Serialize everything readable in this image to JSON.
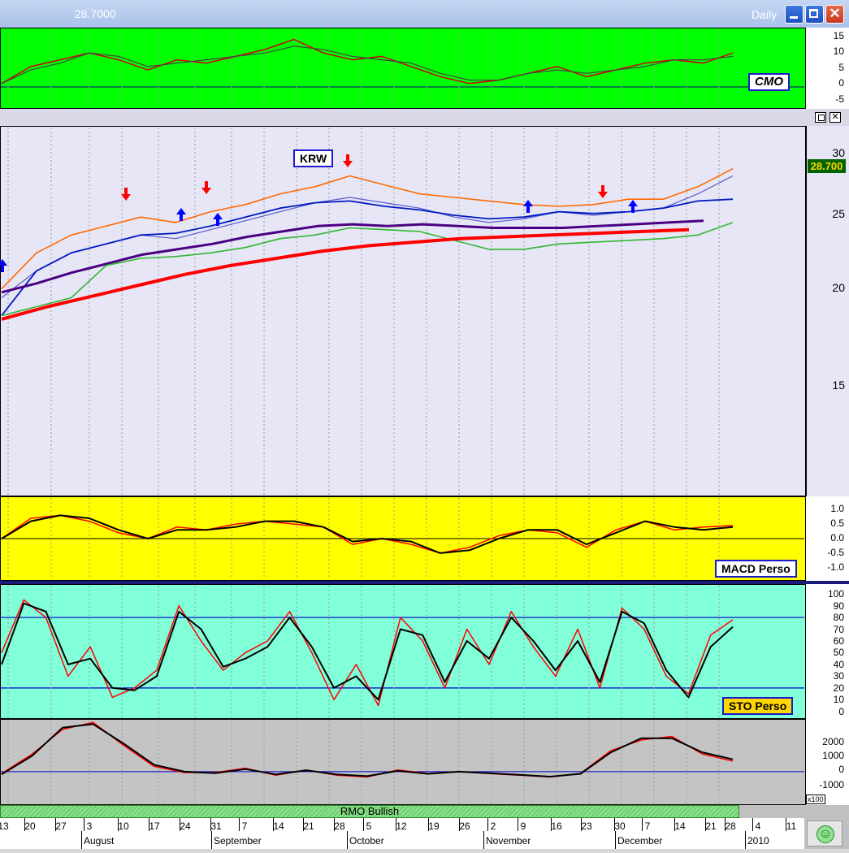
{
  "window": {
    "title_value": "28.7000",
    "period": "Daily"
  },
  "icons": {
    "minimize": "minimize-icon",
    "restore": "restore-icon",
    "close": "close-icon",
    "smiley": "smiley-icon"
  },
  "colors": {
    "cmo_bg": "#00ff00",
    "price_bg": "#e6e6f7",
    "macd_bg": "#ffff00",
    "sto_bg": "#80ffd9",
    "rmo_bg": "#c4c4c4"
  },
  "cmo": {
    "label": "CMO",
    "axis": [
      "15",
      "10",
      "5",
      "0",
      "-5"
    ],
    "chart_data": {
      "type": "line",
      "series": [
        {
          "values": [
            1,
            6,
            8,
            10,
            8,
            5,
            8,
            7,
            9,
            11,
            14,
            10,
            8,
            9,
            6,
            3,
            1,
            2,
            4,
            6,
            3,
            5,
            7,
            8,
            7,
            10
          ]
        },
        {
          "values": [
            1,
            5,
            7,
            10,
            9,
            6,
            7,
            8,
            9,
            10,
            12,
            11,
            9,
            8,
            7,
            4,
            2,
            2,
            4,
            5,
            4,
            5,
            6,
            8,
            8,
            9
          ]
        }
      ],
      "ylim": [
        -6,
        17
      ]
    }
  },
  "price": {
    "symbol": "KRW",
    "last_price": "28.700",
    "axis": [
      "30",
      "25",
      "20",
      "15"
    ],
    "chart_data": {
      "type": "line",
      "ylim": [
        11,
        31.5
      ],
      "series": [
        {
          "values": [
            22.5,
            24.5,
            25.5,
            26,
            26.5,
            26.2,
            26.8,
            27.2,
            27.8,
            28.2,
            28.8,
            28.3,
            27.8,
            27.6,
            27.4,
            27.2,
            27.1,
            27.2,
            27.5,
            27.5,
            28.2,
            29.2
          ]
        },
        {
          "values": [
            22,
            23.5,
            24.5,
            25,
            25.5,
            25.3,
            25.8,
            26.3,
            26.8,
            27.3,
            27.6,
            27.3,
            27,
            26.5,
            26.2,
            26.4,
            26.8,
            26.6,
            26.8,
            27,
            27.8,
            28.8
          ]
        },
        {
          "values": [
            21,
            23.5,
            24.5,
            25,
            25.5,
            25.6,
            26,
            26.5,
            27,
            27.3,
            27.4,
            27.1,
            26.9,
            26.6,
            26.4,
            26.5,
            26.8,
            26.7,
            26.8,
            27,
            27.4,
            27.5
          ]
        },
        {
          "values": [
            22.3,
            22.8,
            23.4,
            23.9,
            24.4,
            24.7,
            25,
            25.4,
            25.7,
            26,
            26.1,
            26,
            26.1,
            26,
            25.9,
            25.9,
            25.9,
            26,
            26.1,
            26.2,
            26.3
          ]
        },
        {
          "values": [
            21,
            21.5,
            22,
            23.8,
            24.2,
            24.3,
            24.5,
            24.8,
            25.3,
            25.5,
            25.9,
            25.8,
            25.7,
            25.2,
            24.7,
            24.7,
            25,
            25.1,
            25.2,
            25.3,
            25.5,
            26.2
          ]
        },
        {
          "values": [
            20.8,
            21.5,
            22.1,
            22.7,
            23.3,
            23.8,
            24.2,
            24.6,
            24.9,
            25.1,
            25.3,
            25.4,
            25.5,
            25.6,
            25.7,
            25.8
          ]
        }
      ]
    }
  },
  "macd": {
    "label": "MACD Perso",
    "axis": [
      "1.0",
      "0.5",
      "0.0",
      "-0.5",
      "-1.0"
    ],
    "chart_data": {
      "type": "line",
      "ylim": [
        -1.4,
        1.4
      ],
      "series": [
        {
          "values": [
            0,
            0.7,
            0.8,
            0.6,
            0.2,
            0,
            0.4,
            0.3,
            0.5,
            0.6,
            0.5,
            0.4,
            -0.2,
            0,
            -0.2,
            -0.5,
            -0.3,
            0.1,
            0.3,
            0.2,
            -0.3,
            0.3,
            0.6,
            0.3,
            0.4,
            0.45
          ]
        },
        {
          "values": [
            0,
            0.6,
            0.8,
            0.7,
            0.3,
            0,
            0.3,
            0.3,
            0.4,
            0.6,
            0.6,
            0.4,
            -0.1,
            0,
            -0.1,
            -0.5,
            -0.4,
            0,
            0.3,
            0.3,
            -0.2,
            0.2,
            0.6,
            0.4,
            0.3,
            0.4
          ]
        }
      ]
    }
  },
  "sto": {
    "label": "STO Perso",
    "axis": [
      "100",
      "90",
      "80",
      "70",
      "60",
      "50",
      "40",
      "30",
      "20",
      "10",
      "0"
    ],
    "levels": [
      80,
      20
    ],
    "chart_data": {
      "type": "line",
      "ylim": [
        -5,
        107
      ],
      "series": [
        {
          "values": [
            50,
            95,
            80,
            30,
            55,
            12,
            20,
            35,
            90,
            60,
            35,
            50,
            60,
            85,
            50,
            10,
            40,
            5,
            80,
            60,
            20,
            70,
            40,
            85,
            55,
            30,
            70,
            20,
            88,
            70,
            30,
            15,
            65,
            78
          ]
        },
        {
          "values": [
            40,
            92,
            85,
            40,
            45,
            20,
            18,
            30,
            85,
            70,
            38,
            45,
            55,
            80,
            55,
            20,
            30,
            10,
            70,
            65,
            25,
            60,
            45,
            80,
            60,
            35,
            60,
            25,
            85,
            75,
            35,
            12,
            55,
            72
          ]
        }
      ]
    }
  },
  "rmo": {
    "label": "RMO Bullish",
    "axis": [
      "2000",
      "1000",
      "0",
      "-1000"
    ],
    "multiplier": "x100",
    "chart_data": {
      "type": "line",
      "ylim": [
        -1800,
        2900
      ],
      "series": [
        {
          "values": [
            -100,
            1000,
            2400,
            2800,
            1500,
            300,
            -50,
            -50,
            200,
            -200,
            100,
            -200,
            -300,
            100,
            -100,
            0,
            -100,
            -200,
            -300,
            -100,
            1200,
            1800,
            2000,
            1000,
            600
          ]
        },
        {
          "values": [
            -150,
            900,
            2500,
            2700,
            1600,
            400,
            0,
            -80,
            150,
            -150,
            80,
            -150,
            -250,
            50,
            -120,
            0,
            -80,
            -180,
            -280,
            -120,
            1100,
            1900,
            1900,
            1100,
            700
          ]
        }
      ]
    }
  },
  "dates": {
    "days": [
      "13",
      "20",
      "27",
      "3",
      "10",
      "17",
      "24",
      "31",
      "7",
      "14",
      "21",
      "28",
      "5",
      "12",
      "19",
      "26",
      "2",
      "9",
      "16",
      "23",
      "30",
      "7",
      "14",
      "21",
      "28",
      "4",
      "11"
    ],
    "months": [
      "August",
      "September",
      "October",
      "November",
      "December",
      "2010"
    ]
  }
}
